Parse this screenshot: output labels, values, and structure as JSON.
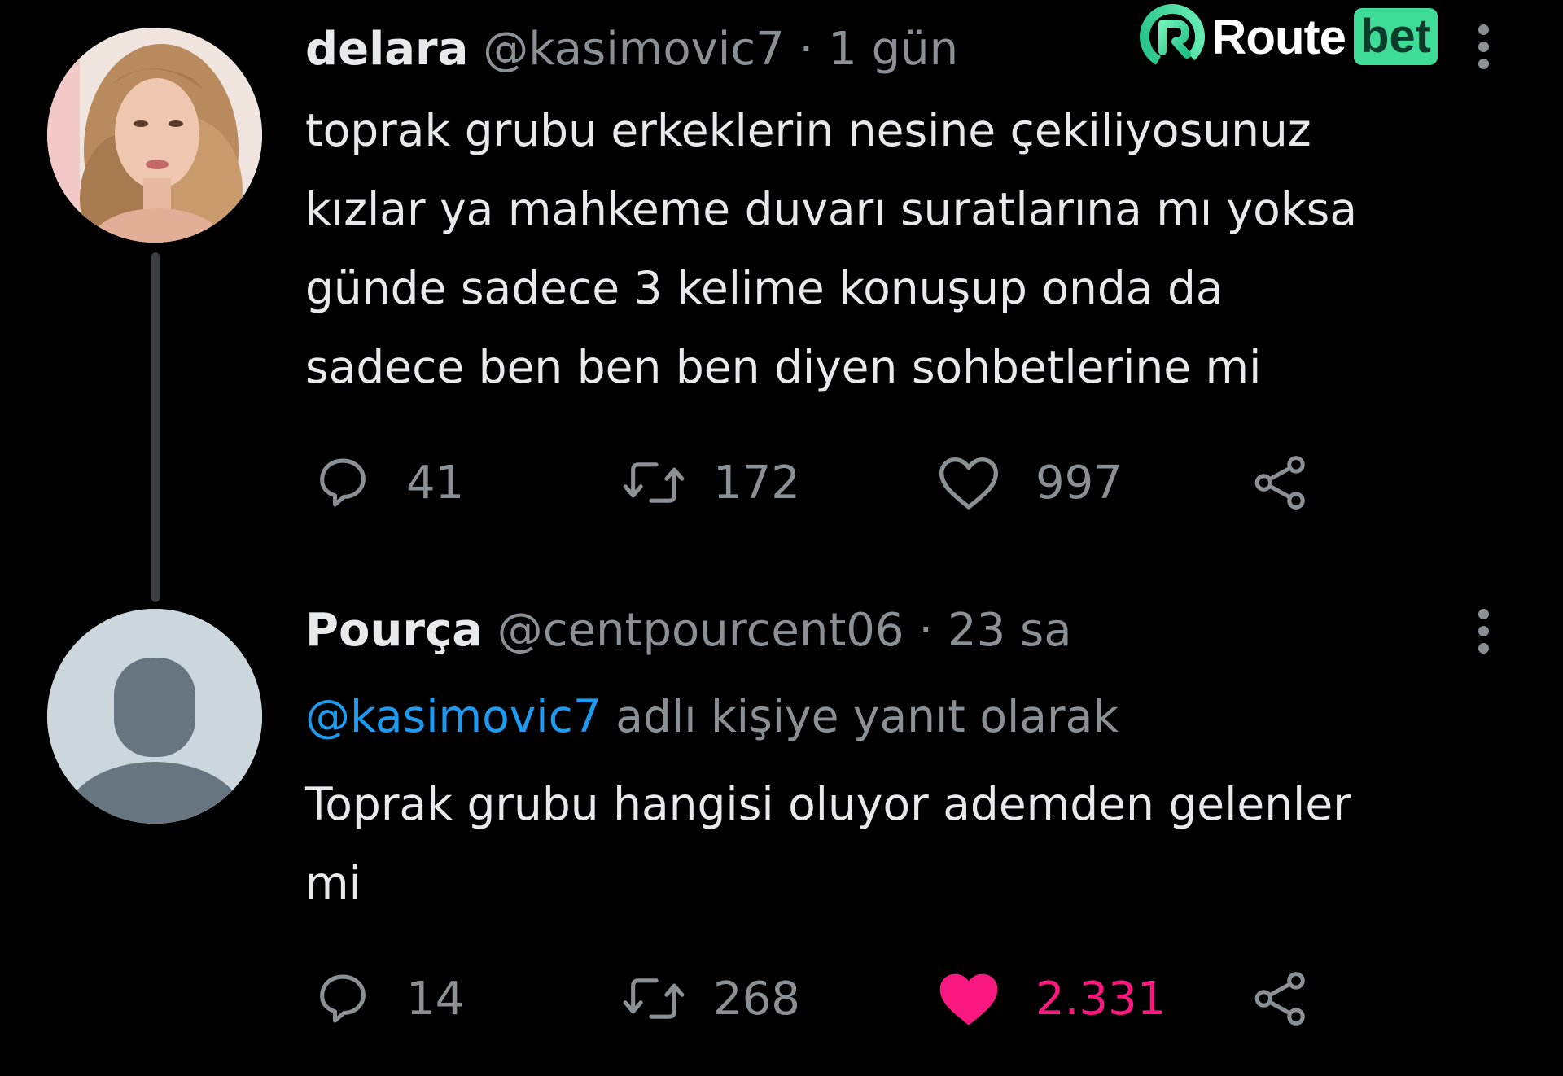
{
  "watermark": {
    "text_route": "Route",
    "text_bet": "bet",
    "accent_color": "#3ddc97"
  },
  "tweets": [
    {
      "name": "delara",
      "handle": "@kasimovic7",
      "separator": "·",
      "time": "1 gün",
      "text_lines": [
        "toprak grubu erkeklerin nesine çekiliyosunuz",
        "kızlar ya mahkeme duvarı suratlarına mı yoksa",
        "günde sadece 3 kelime konuşup onda da",
        "sadece ben ben ben diyen sohbetlerine mi"
      ],
      "replies": "41",
      "retweets": "172",
      "likes": "997",
      "liked": false,
      "avatar": "user-photo-avatar"
    },
    {
      "name": "Pourça",
      "handle": "@centpourcent06",
      "separator": "·",
      "time": "23 sa",
      "reply_mention": "@kasimovic7",
      "reply_suffix": "adlı kişiye yanıt olarak",
      "text_lines": [
        "Toprak grubu hangisi oluyor ademden gelenler",
        "mi"
      ],
      "replies": "14",
      "retweets": "268",
      "likes": "2.331",
      "liked": true,
      "avatar": "default-avatar"
    }
  ],
  "colors": {
    "background": "#000000",
    "text": "#e7e9ea",
    "secondary": "#8b9095",
    "link": "#1d9bf0",
    "like": "#f91880"
  }
}
